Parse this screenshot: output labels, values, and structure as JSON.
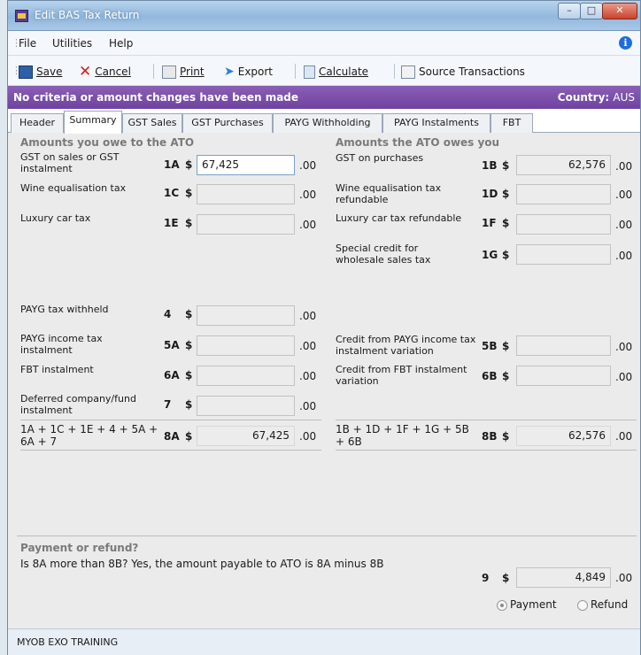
{
  "window": {
    "title": "Edit BAS Tax Return"
  },
  "menu": [
    "File",
    "Utilities",
    "Help"
  ],
  "toolbar": {
    "save": "Save",
    "cancel": "Cancel",
    "print": "Print",
    "export": "Export",
    "calculate": "Calculate",
    "source": "Source Transactions"
  },
  "banner": {
    "message": "No criteria or amount changes have been made",
    "country_label": "Country:",
    "country_value": "AUS"
  },
  "tabs": [
    "Header",
    "Summary",
    "GST Sales",
    "GST Purchases",
    "PAYG Withholding",
    "PAYG Instalments",
    "FBT"
  ],
  "owe": {
    "title": "Amounts you owe to the ATO",
    "rows": [
      {
        "label": "GST on sales or GST instalment",
        "code": "1A",
        "currency": "$",
        "value": "67,425",
        "cents": ".00"
      },
      {
        "label": "Wine equalisation tax",
        "code": "1C",
        "currency": "$",
        "value": "",
        "cents": ".00"
      },
      {
        "label": "Luxury car tax",
        "code": "1E",
        "currency": "$",
        "value": "",
        "cents": ".00"
      },
      {
        "label": "PAYG tax withheld",
        "code": "4",
        "currency": "$",
        "value": "",
        "cents": ".00"
      },
      {
        "label": "PAYG income tax instalment",
        "code": "5A",
        "currency": "$",
        "value": "",
        "cents": ".00"
      },
      {
        "label": "FBT instalment",
        "code": "6A",
        "currency": "$",
        "value": "",
        "cents": ".00"
      },
      {
        "label": "Deferred company/fund instalment",
        "code": "7",
        "currency": "$",
        "value": "",
        "cents": ".00"
      }
    ],
    "total": {
      "label": "1A + 1C + 1E + 4 + 5A + 6A + 7",
      "code": "8A",
      "currency": "$",
      "value": "67,425",
      "cents": ".00"
    }
  },
  "owed": {
    "title": "Amounts the ATO owes you",
    "rows": [
      {
        "label": "GST on purchases",
        "code": "1B",
        "currency": "$",
        "value": "62,576",
        "cents": ".00"
      },
      {
        "label": "Wine equalisation tax refundable",
        "code": "1D",
        "currency": "$",
        "value": "",
        "cents": ".00"
      },
      {
        "label": "Luxury car tax refundable",
        "code": "1F",
        "currency": "$",
        "value": "",
        "cents": ".00"
      },
      {
        "label": "Special credit for wholesale sales tax",
        "code": "1G",
        "currency": "$",
        "value": "",
        "cents": ".00"
      },
      {
        "label": "Credit from PAYG income tax instalment variation",
        "code": "5B",
        "currency": "$",
        "value": "",
        "cents": ".00"
      },
      {
        "label": "Credit from FBT instalment variation",
        "code": "6B",
        "currency": "$",
        "value": "",
        "cents": ".00"
      }
    ],
    "total": {
      "label": "1B + 1D + 1F + 1G + 5B + 6B",
      "code": "8B",
      "currency": "$",
      "value": "62,576",
      "cents": ".00"
    }
  },
  "payment": {
    "title": "Payment or refund?",
    "text": "Is 8A more than 8B? Yes, the amount payable to ATO is 8A minus 8B",
    "code": "9",
    "currency": "$",
    "value": "4,849",
    "cents": ".00",
    "option_payment": "Payment",
    "option_refund": "Refund",
    "selected": "Payment"
  },
  "status": "MYOB EXO TRAINING"
}
